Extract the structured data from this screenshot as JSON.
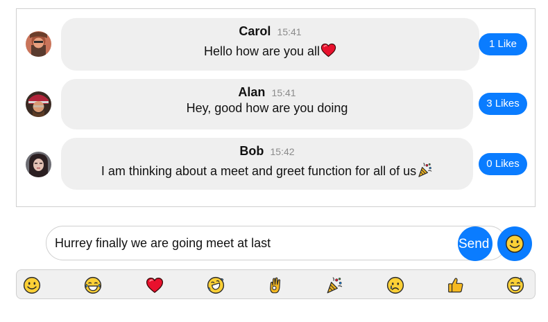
{
  "messages": [
    {
      "name": "Carol",
      "time": "15:41",
      "text": "Hello how are you all",
      "emoji": "heart-icon",
      "likes_label": "1 Like"
    },
    {
      "name": "Alan",
      "time": "15:41",
      "text": "Hey, good how are you doing",
      "likes_label": "3 Likes"
    },
    {
      "name": "Bob",
      "time": "15:42",
      "text": "I am thinking about a meet and greet function for all of us",
      "emoji": "party-popper-icon",
      "likes_label": "0 Likes"
    }
  ],
  "composer": {
    "value": "Hurrey finally we are going meet at last",
    "send_label": "Send"
  },
  "emoji_bar": [
    "smiley-icon",
    "tears-of-joy-icon",
    "heart-icon",
    "rolling-laughing-icon",
    "ok-hand-icon",
    "party-popper-icon",
    "crying-face-icon",
    "thumbs-up-icon",
    "grinning-sweat-icon"
  ],
  "colors": {
    "accent": "#0a7cff",
    "bubble": "#efefef",
    "border": "#cfcfcf"
  }
}
